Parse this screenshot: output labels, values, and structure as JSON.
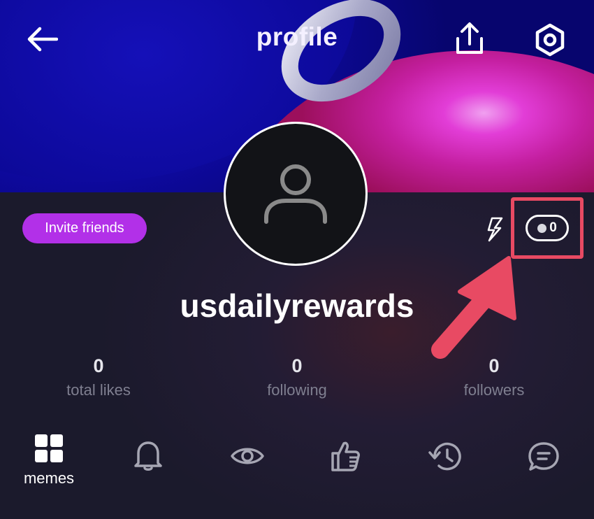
{
  "header": {
    "title": "profile",
    "back_icon": "arrow-left-icon",
    "share_icon": "share-upload-icon",
    "settings_icon": "hexagon-settings-icon"
  },
  "profile": {
    "avatar_icon": "user-placeholder-icon",
    "invite_label": "Invite friends",
    "boost_icon": "lightning-icon",
    "coin_count": "0",
    "username": "usdailyrewards"
  },
  "stats": [
    {
      "value": "0",
      "label": "total likes"
    },
    {
      "value": "0",
      "label": "following"
    },
    {
      "value": "0",
      "label": "followers"
    }
  ],
  "tabs": [
    {
      "icon": "grid-icon",
      "label": "memes",
      "active": true
    },
    {
      "icon": "bell-icon",
      "label": "",
      "active": false
    },
    {
      "icon": "eye-icon",
      "label": "",
      "active": false
    },
    {
      "icon": "thumbs-up-icon",
      "label": "",
      "active": false
    },
    {
      "icon": "history-icon",
      "label": "",
      "active": false
    },
    {
      "icon": "chat-icon",
      "label": "",
      "active": false
    }
  ],
  "colors": {
    "accent_purple": "#b230e8",
    "highlight_red": "#e84a63",
    "background": "#1b1a2c"
  }
}
